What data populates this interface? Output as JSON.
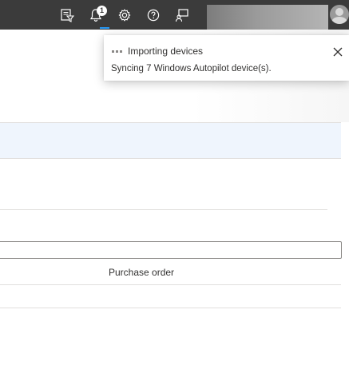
{
  "topbar": {
    "icons": [
      "directory-filter-icon",
      "bell-icon",
      "gear-icon",
      "help-icon",
      "feedback-icon"
    ],
    "notification_count": "1"
  },
  "notification": {
    "title": "Importing devices",
    "message": "Syncing 7 Windows Autopilot device(s)."
  },
  "table": {
    "column_header": "Purchase order"
  },
  "colors": {
    "topbar": "#3b3b3b",
    "accent": "#2899f5",
    "selected_row": "#eff5fd"
  }
}
